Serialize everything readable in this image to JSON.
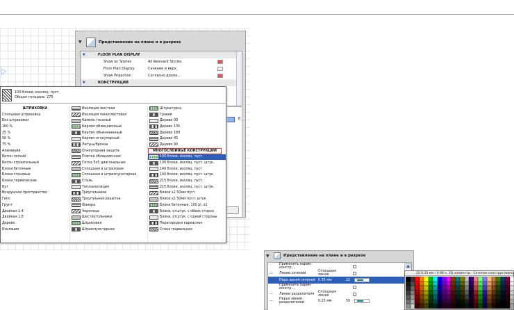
{
  "settings_panel": {
    "title": "Представление на плане и в разрезе",
    "sections": [
      {
        "label": "FLOOR PLAN DISPLAY"
      },
      {
        "label": "КОНСТРУКЦИЯ"
      }
    ],
    "rows": [
      {
        "name": "Show on Stories",
        "value": "All Relevant Stories"
      },
      {
        "name": "Floor Plan Display",
        "value": "Сечение и верх"
      },
      {
        "name": "Show Projection",
        "value": "Согласно диапа..."
      }
    ],
    "side_value": "8"
  },
  "popup": {
    "selected_name": "100 блоки, изоляц. пуст.",
    "total_thickness": "Общая толщина: 275",
    "col1": [
      "ШТРИХОВКА",
      "Сплошная штриховка",
      "Без штриховки",
      "100 %",
      "25 %",
      "50 %",
      "75 %",
      "Алюминий",
      "Бетон легкий",
      "Бетон строительный",
      "Блоки бетонные",
      "Блоки стеновые",
      "Блоки термические",
      "Бут",
      "Воздушное пространство",
      "Гипс",
      "Грунт",
      "Двойная 1:4",
      "Двойная 1:8",
      "Дерево",
      "Изоляция"
    ],
    "col2": [
      "Изоляция жесткая",
      "Изоляция пенопластовая",
      "Камень тесаный",
      "Кирпич облицовочный",
      "Кирпич обыкновенный",
      "Кирпич огнеупорный",
      "Латунь/бронза",
      "Огнеупорная защита",
      "Плитка облицовочная",
      "Сетка 5x5 диагональная",
      "Сплошная и штриховая",
      "Сплошная и штрихпунктирная",
      "Сталь",
      "Теплоизоляция",
      "Треугольники",
      "Треугольная решетка",
      "Фанера",
      "Черепица",
      "Шестиугольники",
      "Штриховая",
      "Штрихпунктирная"
    ],
    "col3": [
      "Штукатурка",
      "Гравий",
      "Дерево 00",
      "Дерево 135",
      "Дерево 180",
      "Дерево 45",
      "Дерево 90",
      "МНОГОСЛОЙНЫЕ КОНСТРУКЦИИ",
      "100 блоки, изоляц. пуст.",
      "100 блоки, изоляц. пуст. штук.",
      "140 блоки, изоляц. пуст.",
      "140 блоки, изоляц. пуст. штук.",
      "215 блоки, изоляц. пуст.",
      "215 блоки, изоляц. пуст. штук.",
      "Блоки x2 50мм пуст.",
      "Блоки x2 50мм пуст. штук.",
      "Блоки бетонные, 100 pl. x2",
      "Блоки, отштук. с обеих сторон",
      "Блоки, отштук. с одной стороны",
      "Перегородка каркасная",
      "Стена подвальная"
    ]
  },
  "bottom_panel": {
    "title": "Представление на плане и в разрезе",
    "rows": [
      {
        "name": "Применить парам. констр....",
        "value": ""
      },
      {
        "name": "Линии сечений",
        "value": "Сплошная линия"
      },
      {
        "name": "Перо линий сечений",
        "value": "0.35 мм",
        "extra": "22"
      },
      {
        "name": "Применить парам. констр....",
        "value": ""
      },
      {
        "name": "Линии разделителя",
        "value": "Сплошная линия"
      },
      {
        "name": "Перья линий-разделителей",
        "value": "0.25 мм",
        "extra": "50"
      }
    ]
  },
  "palette": {
    "header": "22  0.35 мм / 0.99 п. 2D элементы - Сечение конструктивное",
    "colors": [
      "#000000",
      "#333333",
      "#ff0000",
      "#ff8000",
      "#ffff00",
      "#00c000",
      "#00ffff",
      "#0000ff",
      "#8000ff",
      "#ff00ff",
      "#804000",
      "#008080",
      "#808000",
      "#c0c0c0",
      "#400080",
      "#ff8080",
      "#80ff80",
      "#8080ff",
      "#ffc080",
      "#c08040",
      "#408000",
      "#004080",
      "#800040",
      "#ffffff",
      "#1a1a1a",
      "#4d4d4d",
      "#e00000",
      "#e07000",
      "#e0e000",
      "#00a000",
      "#00d0d0",
      "#0000d0",
      "#7000d0",
      "#d000d0",
      "#703000",
      "#006060",
      "#606000",
      "#a0a0a0",
      "#300060",
      "#e06060",
      "#60e060",
      "#6060e0",
      "#e0a060",
      "#a06030",
      "#306000",
      "#003060",
      "#600030",
      "#f0f0f0",
      "#262626",
      "#666666",
      "#c00000",
      "#c06000",
      "#c0c000",
      "#008000",
      "#00a0a0",
      "#0000a0",
      "#6000a0",
      "#a000a0",
      "#602000",
      "#004040",
      "#404000",
      "#808080",
      "#200040",
      "#c04040",
      "#40c040",
      "#4040c0",
      "#c08040",
      "#804020",
      "#204000",
      "#002040",
      "#400020",
      "#e0e0e0",
      "#404040",
      "#808080",
      "#a00000",
      "#a05000",
      "#a0a000",
      "#006000",
      "#008080",
      "#000080",
      "#500080",
      "#800080",
      "#501000",
      "#003030",
      "#303000",
      "#606060",
      "#100020",
      "#a02020",
      "#20a020",
      "#2020a0",
      "#a06020",
      "#603010",
      "#103000",
      "#001030",
      "#300010",
      "#d0d0d0",
      "#595959",
      "#999999",
      "#800000",
      "#804000",
      "#808000",
      "#004000",
      "#006060",
      "#000060",
      "#400060",
      "#600060",
      "#400800",
      "#002020",
      "#202000",
      "#404040",
      "#180030",
      "#801010",
      "#108010",
      "#101080",
      "#804010",
      "#402008",
      "#082000",
      "#000820",
      "#200008",
      "#c0c0c0",
      "#737373",
      "#b3b3b3",
      "#600000",
      "#603000",
      "#606000",
      "#003000",
      "#004040",
      "#000040",
      "#300040",
      "#400040",
      "#300400",
      "#001010",
      "#101000",
      "#202020",
      "#0c0018",
      "#600808",
      "#086008",
      "#080860",
      "#603008",
      "#301004",
      "#041000",
      "#000410",
      "#100004",
      "#b0b0b0",
      "#8c8c8c",
      "#cccccc",
      "#400000",
      "#402000",
      "#404000",
      "#002000",
      "#002020",
      "#000020",
      "#200020",
      "#200020",
      "#200200",
      "#000808",
      "#080800",
      "#101010",
      "#06000c",
      "#400404",
      "#044004",
      "#040440",
      "#402004",
      "#200802",
      "#020800",
      "#000208",
      "#080002",
      "#a0a0a0"
    ]
  }
}
